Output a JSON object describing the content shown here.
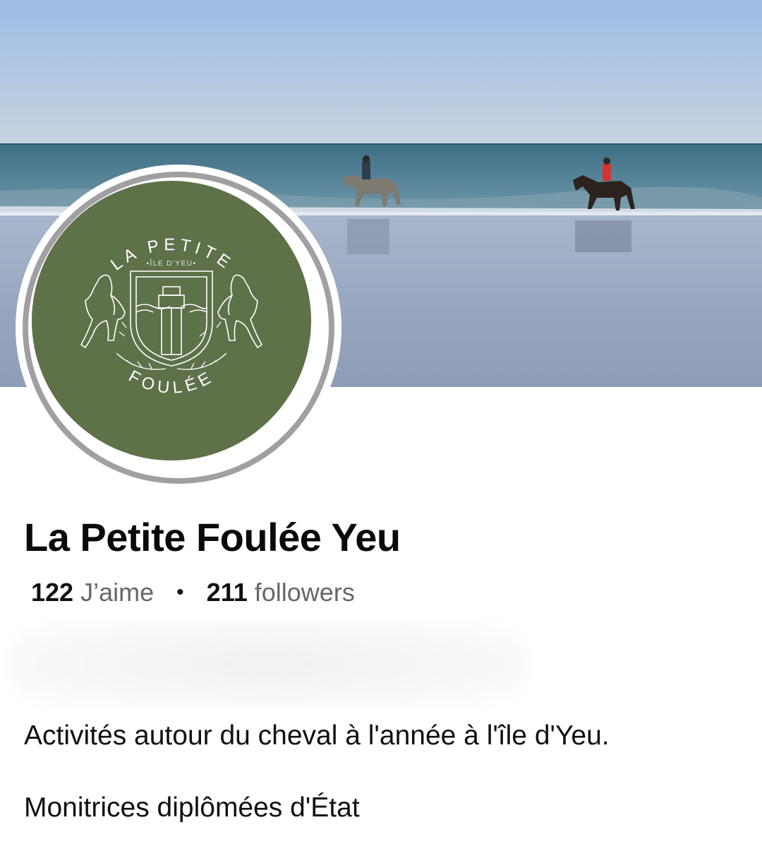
{
  "cover": {
    "icon": "cover-photo-beach-horses"
  },
  "avatar": {
    "logo_text_top": "LA PETITE",
    "logo_text_sub": "•ÎLE D'YEU•",
    "logo_text_bottom": "FOULÉE",
    "color": "#5e7149"
  },
  "page": {
    "title": "La Petite Foulée Yeu",
    "likes_count": "122",
    "likes_label": "J’aime",
    "separator": "•",
    "followers_count": "211",
    "followers_label": "followers"
  },
  "bio": {
    "line1": "Activités autour du cheval à l'année à l'île d'Yeu.",
    "line2": "Monitrices diplômées d'État"
  }
}
